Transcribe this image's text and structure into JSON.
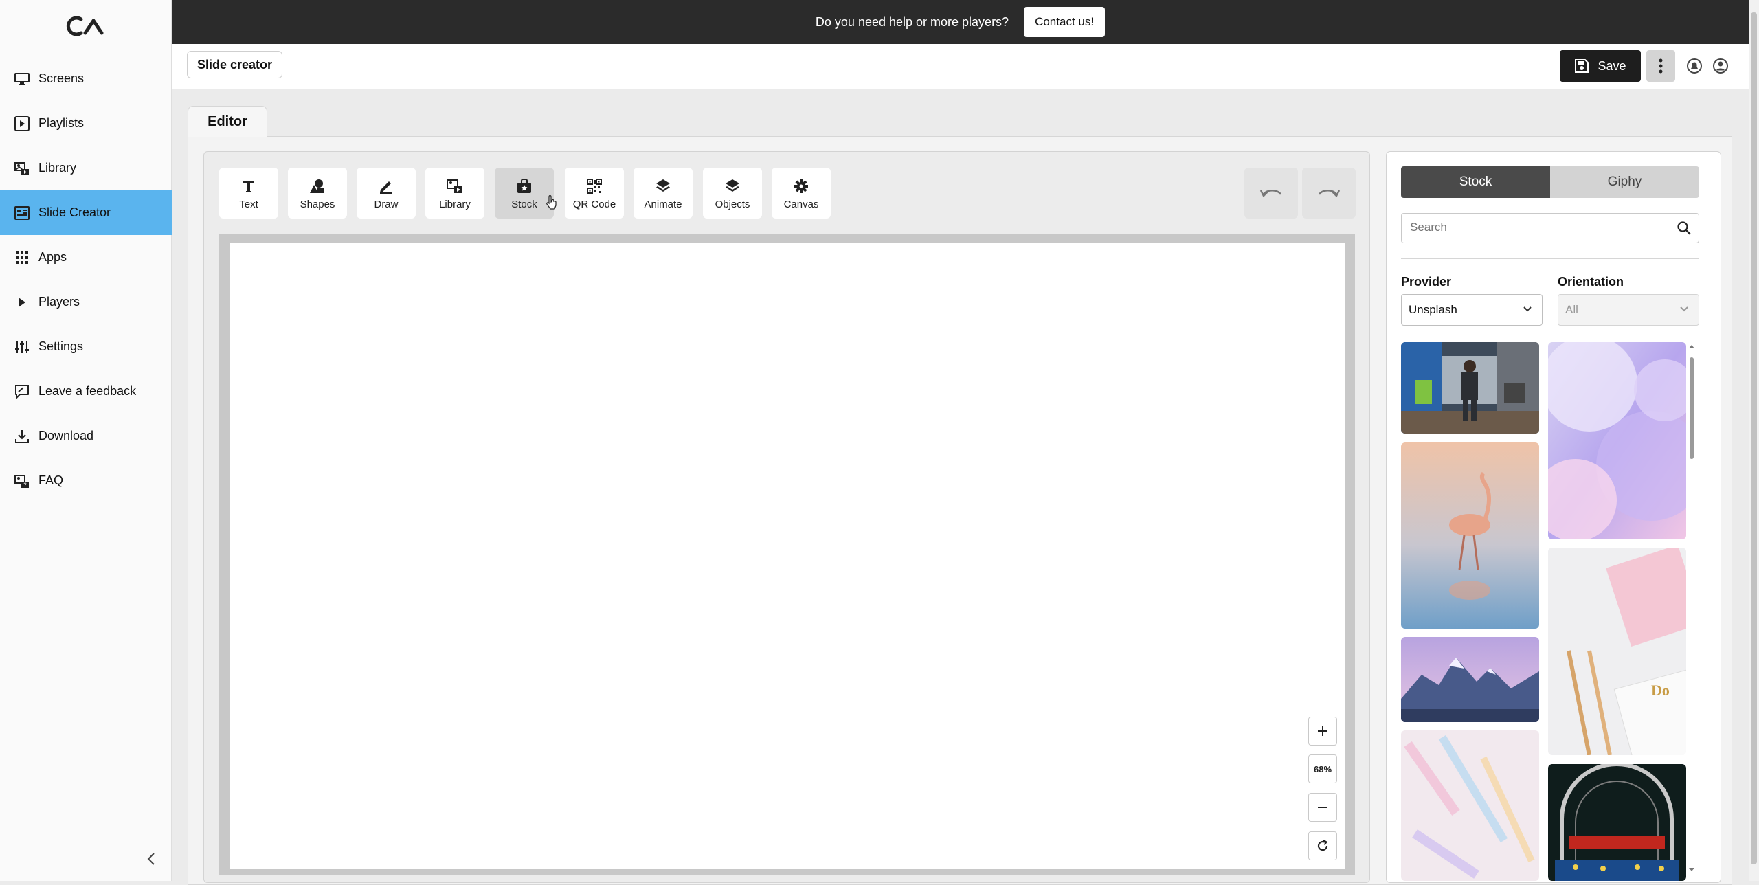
{
  "sidebar": {
    "items": [
      {
        "label": "Screens",
        "icon": "monitor-icon"
      },
      {
        "label": "Playlists",
        "icon": "playlist-icon"
      },
      {
        "label": "Library",
        "icon": "library-icon"
      },
      {
        "label": "Slide Creator",
        "icon": "slide-creator-icon",
        "active": true
      },
      {
        "label": "Apps",
        "icon": "apps-grid-icon"
      },
      {
        "label": "Players",
        "icon": "play-icon"
      },
      {
        "label": "Settings",
        "icon": "sliders-icon"
      },
      {
        "label": "Leave a feedback",
        "icon": "feedback-icon"
      },
      {
        "label": "Download",
        "icon": "download-icon"
      },
      {
        "label": "FAQ",
        "icon": "faq-icon"
      }
    ],
    "collapse_icon": "chevron-left-icon"
  },
  "banner": {
    "text": "Do you need help or more players?",
    "button": "Contact us!"
  },
  "header": {
    "breadcrumb": "Slide creator",
    "save_label": "Save"
  },
  "tabs": {
    "editor": "Editor"
  },
  "toolbar": {
    "tools": [
      {
        "label": "Text",
        "icon": "text-icon"
      },
      {
        "label": "Shapes",
        "icon": "shapes-icon"
      },
      {
        "label": "Draw",
        "icon": "pencil-icon"
      },
      {
        "label": "Library",
        "icon": "library-icon"
      },
      {
        "label": "Stock",
        "icon": "stock-bag-icon",
        "active": true
      },
      {
        "label": "QR Code",
        "icon": "qr-code-icon"
      },
      {
        "label": "Animate",
        "icon": "layers-icon"
      },
      {
        "label": "Objects",
        "icon": "objects-layers-icon"
      },
      {
        "label": "Canvas",
        "icon": "gear-icon"
      }
    ]
  },
  "zoom": {
    "level": "68%"
  },
  "stock_panel": {
    "tab_stock": "Stock",
    "tab_giphy": "Giphy",
    "search_placeholder": "Search",
    "provider_label": "Provider",
    "provider_value": "Unsplash",
    "orientation_label": "Orientation",
    "orientation_value": "All"
  },
  "colors": {
    "active_nav": "#5ab4ee",
    "banner_bg": "#2b2b2b",
    "save_bg": "#1e1e1e"
  }
}
